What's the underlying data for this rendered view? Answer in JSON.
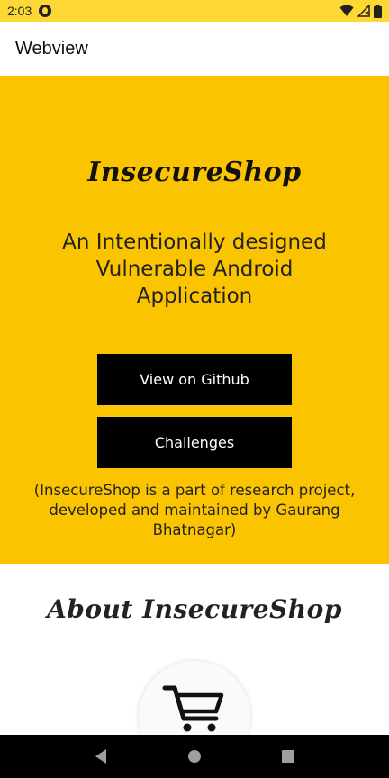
{
  "status_bar": {
    "time": "2:03",
    "icons": [
      "app-badge-icon",
      "wifi-icon",
      "signal-icon",
      "battery-icon"
    ]
  },
  "app_bar": {
    "title": "Webview"
  },
  "hero": {
    "brand": "InsecureShop",
    "tagline": "An Intentionally designed Vulnerable Android Application",
    "github_button": "View on Github",
    "challenges_button": "Challenges",
    "credits": "(InsecureShop is a part of research project, developed and maintained by Gaurang Bhatnagar)"
  },
  "about": {
    "title": "About InsecureShop",
    "icon": "shopping-cart-icon"
  },
  "nav_bar": {
    "icons": [
      "back-icon",
      "home-icon",
      "recents-icon"
    ]
  },
  "colors": {
    "status_bar": "#fdd835",
    "hero_background": "#fbc400",
    "button": "#000000",
    "button_text": "#ffffff"
  }
}
